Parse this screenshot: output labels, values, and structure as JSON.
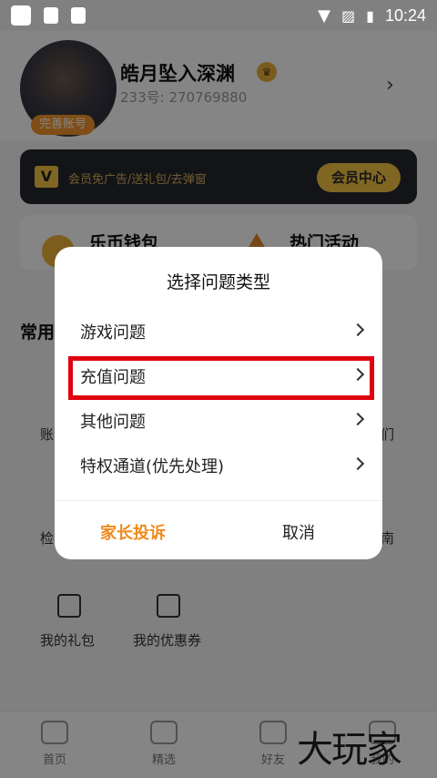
{
  "status_bar": {
    "time": "10:24"
  },
  "profile": {
    "nickname": "皓月坠入深渊",
    "uid": "233号: 270769880",
    "avatar_badge": "完善账号"
  },
  "vip": {
    "logo": "V",
    "promo_text": "会员免广告/送礼包/去弹窗",
    "center_button": "会员中心"
  },
  "cards": [
    {
      "label": "乐币钱包"
    },
    {
      "label": "热门活动"
    }
  ],
  "section": {
    "title_partial": "常用",
    "row1": [
      "账",
      "们"
    ],
    "row2": [
      "检",
      "南"
    ]
  },
  "tools": [
    {
      "label": "我的礼包",
      "icon": "gift-icon"
    },
    {
      "label": "我的优惠券",
      "icon": "coupon-icon"
    }
  ],
  "bottom_nav": [
    {
      "label": "首页",
      "icon": "gamepad-icon"
    },
    {
      "label": "精选",
      "icon": "star-icon"
    },
    {
      "label": "好友",
      "icon": "ghost-icon"
    },
    {
      "label": "我的",
      "icon": "profile-icon"
    }
  ],
  "watermark": "大玩家",
  "dialog": {
    "title": "选择问题类型",
    "items": [
      {
        "label": "游戏问题"
      },
      {
        "label": "充值问题",
        "highlighted": true
      },
      {
        "label": "其他问题"
      },
      {
        "label": "特权通道(优先处理)"
      }
    ],
    "complain_button": "家长投诉",
    "cancel_button": "取消"
  },
  "colors": {
    "accent_orange": "#f08a1c",
    "vip_gold": "#f3c443",
    "highlight_red": "#e00010"
  }
}
